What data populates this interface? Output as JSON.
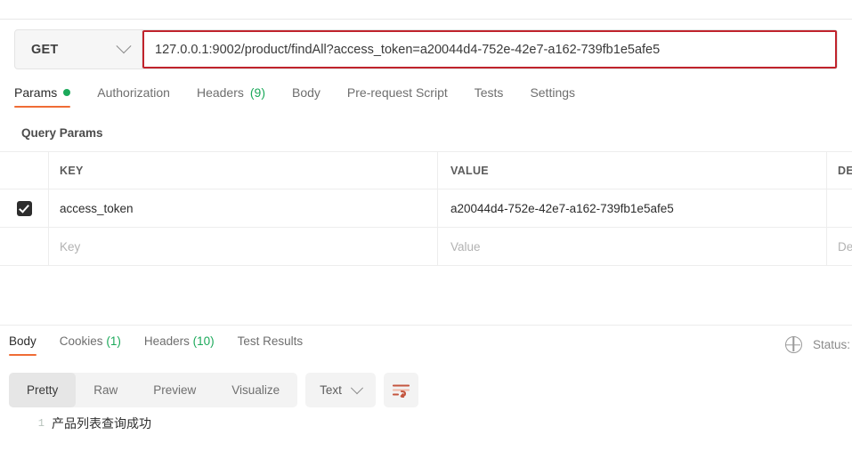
{
  "request": {
    "method": "GET",
    "url": "127.0.0.1:9002/product/findAll?access_token=a20044d4-752e-42e7-a162-739fb1e5afe5",
    "tabs": [
      {
        "label": "Params",
        "badge": "",
        "dot": true,
        "active": true
      },
      {
        "label": "Authorization",
        "badge": "",
        "dot": false,
        "active": false
      },
      {
        "label": "Headers",
        "badge": "(9)",
        "dot": false,
        "active": false
      },
      {
        "label": "Body",
        "badge": "",
        "dot": false,
        "active": false
      },
      {
        "label": "Pre-request Script",
        "badge": "",
        "dot": false,
        "active": false
      },
      {
        "label": "Tests",
        "badge": "",
        "dot": false,
        "active": false
      },
      {
        "label": "Settings",
        "badge": "",
        "dot": false,
        "active": false
      }
    ]
  },
  "params": {
    "section_title": "Query Params",
    "columns": {
      "key": "KEY",
      "value": "VALUE",
      "description": "DE"
    },
    "rows": [
      {
        "checked": true,
        "key": "access_token",
        "value": "a20044d4-752e-42e7-a162-739fb1e5afe5",
        "description": ""
      }
    ],
    "placeholder_row": {
      "key": "Key",
      "value": "Value",
      "description": "De"
    }
  },
  "response": {
    "tabs": [
      {
        "label": "Body",
        "badge": "",
        "active": true
      },
      {
        "label": "Cookies",
        "badge": "(1)",
        "active": false
      },
      {
        "label": "Headers",
        "badge": "(10)",
        "active": false
      },
      {
        "label": "Test Results",
        "badge": "",
        "active": false
      }
    ],
    "status_label": "Status:",
    "view_modes": [
      {
        "label": "Pretty",
        "active": true
      },
      {
        "label": "Raw",
        "active": false
      },
      {
        "label": "Preview",
        "active": false
      },
      {
        "label": "Visualize",
        "active": false
      }
    ],
    "format": "Text",
    "body_lines": [
      {
        "number": "1",
        "text": "产品列表查询成功"
      }
    ]
  },
  "colors": {
    "accent": "#ef6c35",
    "annotation": "#c0232c",
    "success": "#1ba95a"
  }
}
